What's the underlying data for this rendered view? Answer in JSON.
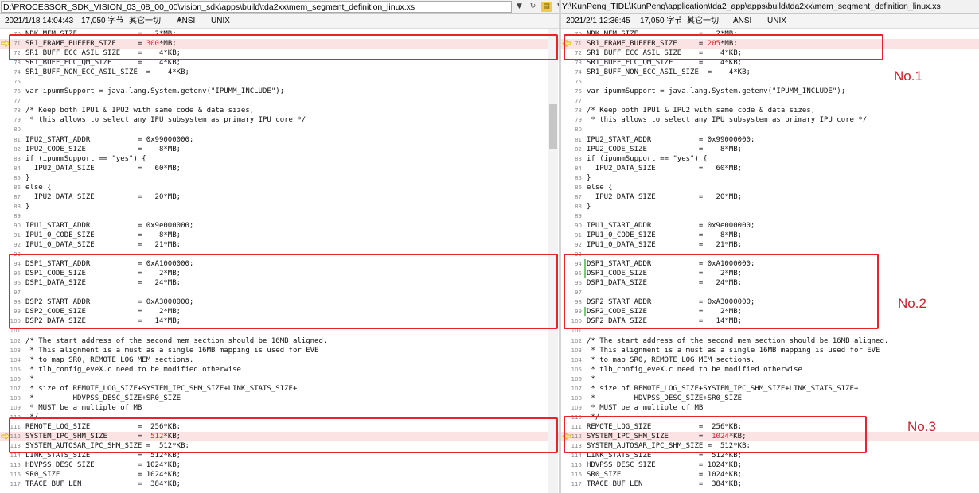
{
  "left": {
    "path": "D:\\PROCESSOR_SDK_VISION_03_08_00_00\\vision_sdk\\apps\\build\\tda2xx\\mem_segment_definition_linux.xs",
    "datetime": "2021/1/18 14:04:43",
    "size": "17,050 字节",
    "other": "其它一切",
    "encoding": "ANSI",
    "eol": "UNIX"
  },
  "right": {
    "path": "Y:\\KunPeng_TIDL\\KunPeng\\application\\tda2_app\\apps\\build\\tda2xx\\mem_segment_definition_linux.xs",
    "datetime": "2021/2/1 12:36:45",
    "size": "17,050 字节",
    "other": "其它一切",
    "encoding": "ANSI",
    "eol": "UNIX"
  },
  "lines": [
    {
      "n": "70",
      "text": "NDK_MEM_SIZE              =   2*MB;"
    },
    {
      "n": "71",
      "pre": "SR1_FRAME_BUFFER_SIZE     = ",
      "left_val": "300",
      "right_val": "205",
      "post": "*MB;",
      "changed": true
    },
    {
      "n": "72",
      "text": "SR1_BUFF_ECC_ASIL_SIZE    =    4*KB;"
    },
    {
      "n": "73",
      "text": "SR1_BUFF_ECC_QM_SIZE      =    4*KB;"
    },
    {
      "n": "74",
      "text": "SR1_BUFF_NON_ECC_ASIL_SIZE  =    4*KB;"
    },
    {
      "n": "75",
      "text": ""
    },
    {
      "n": "76",
      "text": "var ipummSupport = java.lang.System.getenv(\"IPUMM_INCLUDE\");"
    },
    {
      "n": "77",
      "text": ""
    },
    {
      "n": "78",
      "text": "/* Keep both IPU1 & IPU2 with same code & data sizes,"
    },
    {
      "n": "79",
      "text": " * this allows to select any IPU subsystem as primary IPU core */"
    },
    {
      "n": "80",
      "text": ""
    },
    {
      "n": "81",
      "text": "IPU2_START_ADDR           = 0x99000000;"
    },
    {
      "n": "82",
      "text": "IPU2_CODE_SIZE            =    8*MB;"
    },
    {
      "n": "83",
      "text": "if (ipummSupport == \"yes\") {"
    },
    {
      "n": "84",
      "text": "  IPU2_DATA_SIZE          =   60*MB;"
    },
    {
      "n": "85",
      "text": "}"
    },
    {
      "n": "86",
      "text": "else {"
    },
    {
      "n": "87",
      "text": "  IPU2_DATA_SIZE          =   20*MB;"
    },
    {
      "n": "88",
      "text": "}"
    },
    {
      "n": "89",
      "text": ""
    },
    {
      "n": "90",
      "text": "IPU1_START_ADDR           = 0x9e000000;"
    },
    {
      "n": "91",
      "text": "IPU1_0_CODE_SIZE          =    8*MB;"
    },
    {
      "n": "92",
      "text": "IPU1_0_DATA_SIZE          =   21*MB;"
    },
    {
      "n": "93",
      "text": ""
    },
    {
      "n": "94",
      "text": "DSP1_START_ADDR           = 0xA1000000;",
      "rmark": true
    },
    {
      "n": "95",
      "text": "DSP1_CODE_SIZE            =    2*MB;",
      "rmark": true
    },
    {
      "n": "96",
      "text": "DSP1_DATA_SIZE            =   24*MB;"
    },
    {
      "n": "97",
      "text": ""
    },
    {
      "n": "98",
      "text": "DSP2_START_ADDR           = 0xA3000000;"
    },
    {
      "n": "99",
      "text": "DSP2_CODE_SIZE            =    2*MB;",
      "rmark": true
    },
    {
      "n": "100",
      "text": "DSP2_DATA_SIZE            =   14*MB;"
    },
    {
      "n": "101",
      "text": ""
    },
    {
      "n": "102",
      "text": "/* The start address of the second mem section should be 16MB aligned."
    },
    {
      "n": "103",
      "text": " * This alignment is a must as a single 16MB mapping is used for EVE"
    },
    {
      "n": "104",
      "text": " * to map SR0, REMOTE_LOG_MEM sections."
    },
    {
      "n": "105",
      "text": " * tlb_config_eveX.c need to be modified otherwise"
    },
    {
      "n": "106",
      "text": " *"
    },
    {
      "n": "107",
      "text": " * size of REMOTE_LOG_SIZE+SYSTEM_IPC_SHM_SIZE+LINK_STATS_SIZE+"
    },
    {
      "n": "108",
      "text": " *         HDVPSS_DESC_SIZE+SR0_SIZE"
    },
    {
      "n": "109",
      "text": " * MUST be a multiple of MB"
    },
    {
      "n": "110",
      "text": " */"
    },
    {
      "n": "111",
      "text": "REMOTE_LOG_SIZE           =  256*KB;"
    },
    {
      "n": "112",
      "pre": "SYSTEM_IPC_SHM_SIZE       =  ",
      "left_val": "512",
      "right_val": "1024",
      "post": "*KB;",
      "changed": true
    },
    {
      "n": "113",
      "text": "SYSTEM_AUTOSAR_IPC_SHM_SIZE =  512*KB;"
    },
    {
      "n": "114",
      "text": "LINK_STATS_SIZE           =  512*KB;"
    },
    {
      "n": "115",
      "text": "HDVPSS_DESC_SIZE          = 1024*KB;"
    },
    {
      "n": "116",
      "text": "SR0_SIZE                  = 1024*KB;"
    },
    {
      "n": "117",
      "text": "TRACE_BUF_LEN             =  384*KB;"
    }
  ],
  "annotations": [
    "No.1",
    "No.2",
    "No.3"
  ],
  "colors": {
    "box": "#e8242a",
    "changed_value": "#e0201e",
    "changed_row": "#fbe3e3",
    "arrow": "#e2b21a"
  },
  "icons": [
    "caret-down-icon",
    "refresh-icon",
    "open-folder-icon",
    "save-icon"
  ]
}
